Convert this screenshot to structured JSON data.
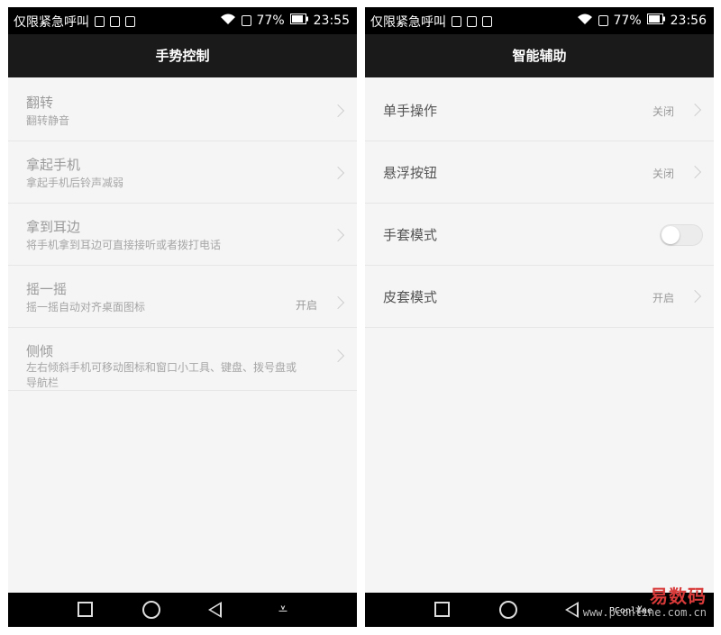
{
  "status_left": {
    "carrier": "仅限紧急呼叫",
    "battery": "77%",
    "time": "23:55"
  },
  "status_right": {
    "carrier": "仅限紧急呼叫",
    "battery": "77%",
    "time": "23:56"
  },
  "left_screen": {
    "title": "手势控制",
    "items": [
      {
        "title": "翻转",
        "subtitle": "翻转静音",
        "value": ""
      },
      {
        "title": "拿起手机",
        "subtitle": "拿起手机后铃声减弱",
        "value": ""
      },
      {
        "title": "拿到耳边",
        "subtitle": "将手机拿到耳边可直接接听或者拨打电话",
        "value": ""
      },
      {
        "title": "摇一摇",
        "subtitle": "摇一摇自动对齐桌面图标",
        "value": "开启"
      },
      {
        "title": "侧倾",
        "subtitle": "左右倾斜手机可移动图标和窗口小工具、键盘、拨号盘或导航栏",
        "value": ""
      }
    ]
  },
  "right_screen": {
    "title": "智能辅助",
    "items": [
      {
        "title": "单手操作",
        "value": "关闭",
        "control": "chevron"
      },
      {
        "title": "悬浮按钮",
        "value": "关闭",
        "control": "chevron"
      },
      {
        "title": "手套模式",
        "value": "",
        "control": "toggle",
        "toggle_on": false
      },
      {
        "title": "皮套模式",
        "value": "开启",
        "control": "chevron"
      }
    ]
  },
  "navbar": {
    "icons": [
      "recent-apps-icon",
      "home-icon",
      "back-icon",
      "notification-pull-icon"
    ]
  },
  "watermark": {
    "text": "易数码",
    "logo_text": "PConline",
    "url": "www.pconline.com.cn"
  }
}
